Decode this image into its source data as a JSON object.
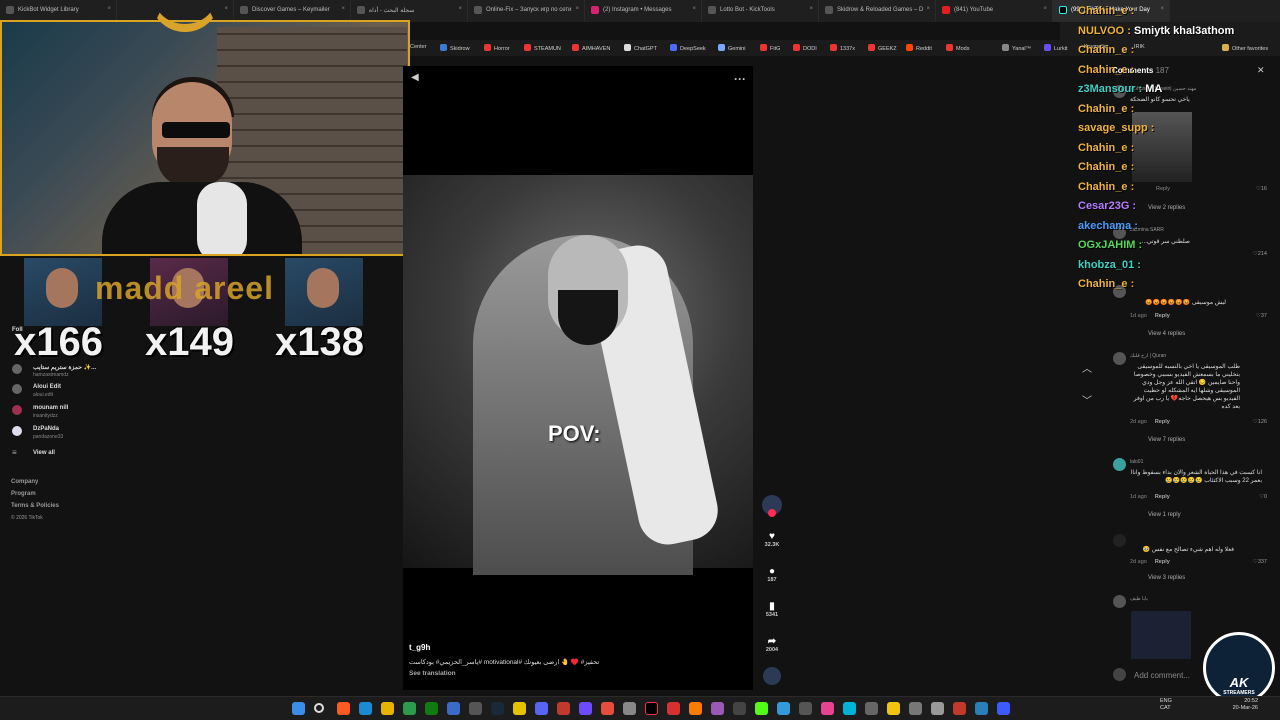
{
  "tabs": [
    {
      "label": "KickBot Widget Library"
    },
    {
      "label": ""
    },
    {
      "label": "Discover Games – Keymailer"
    },
    {
      "label": "سجلة البحث - أداة"
    },
    {
      "label": "Online-Fix – Запуск игр по сети"
    },
    {
      "label": "(2) Instagram • Messages"
    },
    {
      "label": "Lotto Bot - KickTools"
    },
    {
      "label": "Skidrow & Reloaded Games – D"
    },
    {
      "label": "(841) YouTube"
    },
    {
      "label": "(99+) TikTok - Make Your Day"
    }
  ],
  "bookmarks": [
    "Center",
    "Skidrow",
    "Horror",
    "STEAMUN",
    "AIMHAVEN",
    "ChatGPT",
    "DeepSeek",
    "Gemini",
    "FitG",
    "DODI",
    "1337x",
    "GEEKZ",
    "Reddit",
    "Mods",
    "Yanal™",
    "Lurkit",
    "Keymailer",
    "IRIK",
    "Other favorites"
  ],
  "overlay": {
    "multipliers": [
      "x166",
      "x149",
      "x138"
    ],
    "banner": "madd areel"
  },
  "sidebar": {
    "accounts": [
      {
        "name": "حمزة ستريم ستايب ✨...",
        "handle": "hamzastreamdz"
      },
      {
        "name": "Aloui Edit",
        "handle": "aloui.edit"
      },
      {
        "name": "mounam nill",
        "handle": "insanitydzz"
      },
      {
        "name": "DzPaNda",
        "handle": "pandazone33"
      }
    ],
    "view_all": "View all",
    "footer": [
      "Company",
      "Program",
      "Terms & Policies",
      "© 2026 TikTok"
    ],
    "label_fol": "Foll"
  },
  "video": {
    "pov_text": "POV:",
    "author": "t_g9h",
    "caption": "ياسر_الحزيمي# بودكاست# motivational# تحفيز# ♥️ 🤚 ارضى بعيونك",
    "see_translation": "See translation"
  },
  "actions": {
    "likes": "32.3K",
    "comments": "187",
    "saves": "5341",
    "shares": "2004"
  },
  "chat": [
    {
      "user": "Chahin_e :",
      "msg": "",
      "color": "#f0b43c"
    },
    {
      "user": "NULVOO :",
      "msg": "Smiytk khal3athom",
      "color": "#f0b43c"
    },
    {
      "user": "Chahin_e :",
      "msg": "",
      "color": "#f0b43c"
    },
    {
      "user": "Chahin_e :",
      "msg": "",
      "color": "#f0b43c"
    },
    {
      "user": "z3Mansour :",
      "msg": "MA",
      "color": "#3fd1c4"
    },
    {
      "user": "Chahin_e :",
      "msg": "",
      "color": "#f0b43c"
    },
    {
      "user": "savage_supp :",
      "msg": "",
      "color": "#f0b43c"
    },
    {
      "user": "Chahin_e :",
      "msg": "",
      "color": "#f0b43c"
    },
    {
      "user": "Chahin_e :",
      "msg": "",
      "color": "#f0b43c"
    },
    {
      "user": "Chahin_e :",
      "msg": "",
      "color": "#f0b43c"
    },
    {
      "user": "Cesar23G :",
      "msg": "",
      "color": "#b57cff"
    },
    {
      "user": "akechama :",
      "msg": "",
      "color": "#4a9cff"
    },
    {
      "user": "OGxJAHIM :",
      "msg": "",
      "color": "#57d957"
    },
    {
      "user": "khobza_01 :",
      "msg": "",
      "color": "#3fd1c4"
    },
    {
      "user": "Chahin_e :",
      "msg": "",
      "color": "#f0b43c"
    }
  ],
  "comments": {
    "header": "Comments",
    "count": "187",
    "items": [
      {
        "name": "Mohanad Hussein| مهند حسين",
        "text": "ياخي تحسو كانو الضحكة",
        "meta": "",
        "reply": "Reply",
        "likes": "16",
        "views": "View 2 replies"
      },
      {
        "name": "Jazmina SARR",
        "text": "صلطني سر قوتي...",
        "meta": "",
        "reply": "",
        "likes": "214",
        "views": ""
      },
      {
        "name": "",
        "text": "ليش موسيقى 😡😡😡😡😡😡",
        "meta": "1d ago",
        "reply": "Reply",
        "likes": "37",
        "views": "View 4 replies"
      },
      {
        "name": "ارح قلبك | Quran",
        "text": "طلب الموسيقى يا اخي بالنسبه للموسيقى بتخليني ما بسمعش الفيديو بسببي وخصوصا واحنا صايمين 😔 اتقي الله عز وجل ودي الموسيقى وشلها ايه المشكله لو حطيت الفيديو بس هيحصل حاجه💔 يا رب من اوفر بعد كده",
        "meta": "2d ago",
        "reply": "Reply",
        "likes": "126",
        "views": "View 7 replies"
      },
      {
        "name": "lalo01",
        "text": "انا كسبت في هذا الحياة الشعر والان بداء بسقوط واناا بعمر 22 وسبب الاكتئاب 😢😢😢😢😢",
        "meta": "1d ago",
        "reply": "Reply",
        "likes": "0",
        "views": "View 1 reply"
      },
      {
        "name": "",
        "text": "فعلا وله اهم شيء تصالح مع نفس 🥹",
        "meta": "2d ago",
        "reply": "Reply",
        "likes": "337",
        "views": "View 3 replies"
      },
      {
        "name": "بابا طيف",
        "text": "",
        "meta": "",
        "reply": "",
        "likes": "",
        "views": ""
      }
    ],
    "add_placeholder": "Add comment..."
  },
  "logo": {
    "ak": "AK",
    "streamers": "STREAMERS"
  },
  "tray": {
    "lang1": "ENG",
    "lang2": "CAT",
    "time": "20:52",
    "date": "20-Mar-26"
  },
  "colors": {
    "accent": "#d9a520",
    "tiktok_red": "#fe2c55"
  }
}
